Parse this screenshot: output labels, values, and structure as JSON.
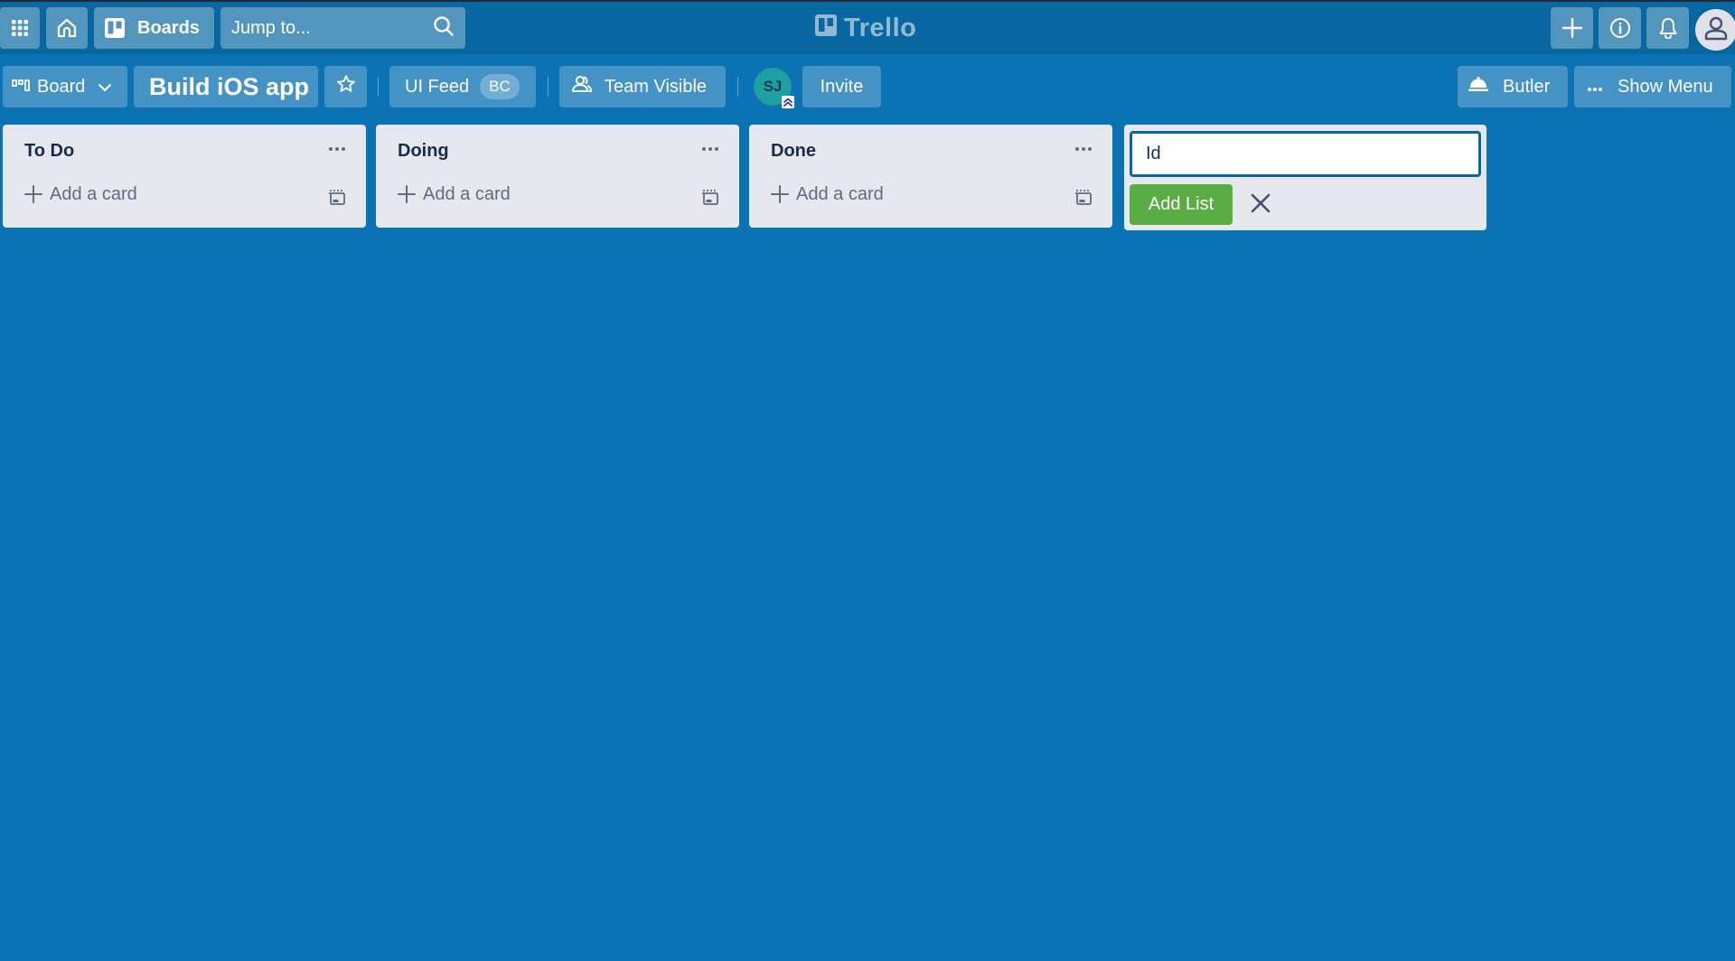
{
  "app": {
    "logo_text": "Trello"
  },
  "header": {
    "boards_label": "Boards",
    "search_placeholder": "Jump to...",
    "icons": {
      "apps": "grid-icon",
      "home": "home-icon",
      "boards": "board-icon",
      "search": "search-icon",
      "create": "plus-icon",
      "info": "info-icon",
      "notifications": "bell-icon",
      "account": "user-icon"
    }
  },
  "board_header": {
    "view_label": "Board",
    "title": "Build iOS app",
    "workspace_label": "UI Feed",
    "workspace_badge": "BC",
    "visibility_label": "Team Visible",
    "member_initials": "SJ",
    "invite_label": "Invite",
    "butler_label": "Butler",
    "menu_label": "Show Menu"
  },
  "lists": [
    {
      "title": "To Do",
      "add_card_label": "Add a card"
    },
    {
      "title": "Doing",
      "add_card_label": "Add a card"
    },
    {
      "title": "Done",
      "add_card_label": "Add a card"
    }
  ],
  "add_list": {
    "input_value": "Id",
    "submit_label": "Add List"
  },
  "colors": {
    "board_background": "#0b72b3",
    "header_background": "#0867a1",
    "list_background": "#e7e8ed",
    "add_button_green": "#5aac44",
    "avatar_teal": "#1e9fa2"
  }
}
